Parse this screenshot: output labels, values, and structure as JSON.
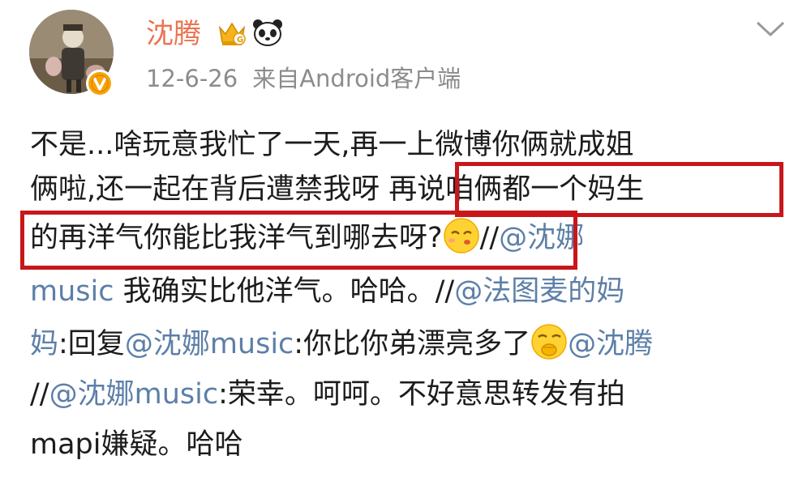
{
  "post": {
    "author": {
      "name": "沈腾",
      "avatar_icon": "avatar-photo",
      "badges": [
        "verified-badge-icon",
        "vip-crown-icon",
        "panda-icon"
      ]
    },
    "date": "12-6-26",
    "source": "来自Android客户端",
    "more_icon": "chevron-down-icon",
    "text_lines": [
      {
        "t1": "不是...啥玩意我忙了一天,再一上微博你俩就成姐"
      },
      {
        "t1": "俩啦,还一起在背后遭禁我呀 ",
        "t2": "再说咱俩都一个妈生"
      },
      {
        "t1": "的再洋气你能比我洋气到哪去呀?",
        "emoji": "sleepy-emoji",
        "t2": "//",
        "m1": "@沈娜"
      },
      {
        "m1": "music",
        "t1": " 我确实比他洋气。哈哈。//",
        "m2": "@法图麦的妈"
      },
      {
        "m1": "妈",
        "t1": ":回复",
        "m2": "@沈娜music",
        "t2": ":你比你弟漂亮多了",
        "emoji": "shy-emoji",
        "m3": "@沈腾"
      },
      {
        "t1": "//",
        "m1": "@沈娜music",
        "t2": ":荣幸。呵呵。不好意思转发有拍"
      },
      {
        "t1": "mapi嫌疑。哈哈"
      }
    ]
  },
  "colors": {
    "username": "#eb7350",
    "mention": "#5d7fa8",
    "meta": "#8c8c8c",
    "highlight_border": "#c8171b",
    "verified": "#f7a300"
  }
}
